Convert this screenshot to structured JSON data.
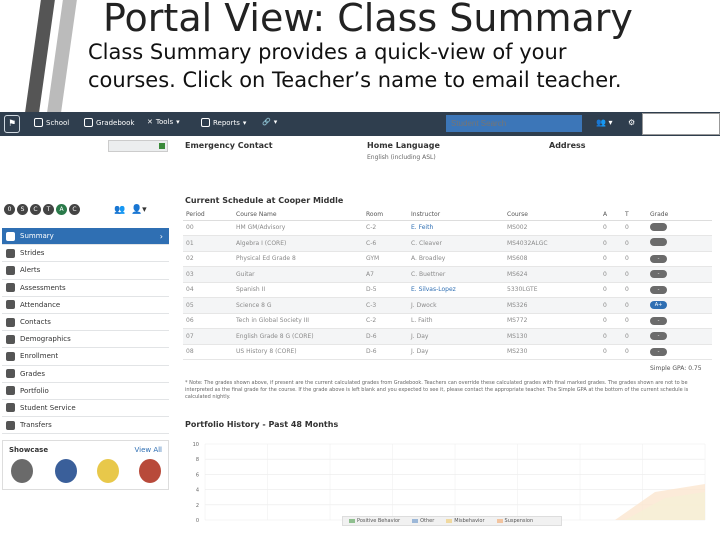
{
  "slide": {
    "title": "Portal View: Class Summary",
    "subtitle_line1": "Class Summary provides a quick-view of your",
    "subtitle_line2": "courses. Click on Teacher’s name to email teacher."
  },
  "navbar": {
    "school": "School",
    "gradebook": "Gradebook",
    "tools": "Tools",
    "reports": "Reports",
    "search_placeholder": "Student Search"
  },
  "left": {
    "circles": [
      "0",
      "S",
      "C",
      "T",
      "A",
      "C"
    ],
    "menu": [
      {
        "label": "Summary",
        "active": true
      },
      {
        "label": "Strides"
      },
      {
        "label": "Alerts"
      },
      {
        "label": "Assessments"
      },
      {
        "label": "Attendance"
      },
      {
        "label": "Contacts"
      },
      {
        "label": "Demographics"
      },
      {
        "label": "Enrollment"
      },
      {
        "label": "Grades"
      },
      {
        "label": "Portfolio"
      },
      {
        "label": "Student Service"
      },
      {
        "label": "Transfers"
      }
    ],
    "showcase_title": "Showcase",
    "view_all": "View All"
  },
  "main": {
    "emergency_contact": "Emergency Contact",
    "home_language": "Home Language",
    "home_language_value": "English (including ASL)",
    "address": "Address",
    "schedule_title": "Current Schedule at Cooper Middle",
    "columns": [
      "Period",
      "Course Name",
      "Room",
      "Instructor",
      "Course",
      "A",
      "T",
      "Grade"
    ],
    "rows": [
      [
        "00",
        "HM GM/Advisory",
        "C-2",
        "E. Feith",
        "MS002",
        "0",
        "0",
        ""
      ],
      [
        "01",
        "Algebra I (CORE)",
        "C-6",
        "C. Cleaver",
        "MS4032ALGC",
        "0",
        "0",
        ""
      ],
      [
        "02",
        "Physical Ed Grade 8",
        "GYM",
        "A. Broadley",
        "MS608",
        "0",
        "0",
        "-"
      ],
      [
        "03",
        "Guitar",
        "A7",
        "C. Buettner",
        "MS624",
        "0",
        "0",
        "-"
      ],
      [
        "04",
        "Spanish II",
        "D-5",
        "E. Silvas-Lopez",
        "5330LGTE",
        "0",
        "0",
        "-"
      ],
      [
        "05",
        "Science 8 G",
        "C-3",
        "J. Dwock",
        "MS326",
        "0",
        "0",
        "A+"
      ],
      [
        "06",
        "Tech in Global Society III",
        "C-2",
        "L. Faith",
        "MS772",
        "0",
        "0",
        "-"
      ],
      [
        "07",
        "English Grade 8 G (CORE)",
        "D-6",
        "J. Day",
        "MS130",
        "0",
        "0",
        "-"
      ],
      [
        "08",
        "US History 8 (CORE)",
        "D-6",
        "J. Day",
        "MS230",
        "0",
        "0",
        "-"
      ]
    ],
    "gpa": "Simple GPA: 0.75",
    "note": "* Note: The grades shown above, if present are the current calculated grades from Gradebook. Teachers can override these calculated grades with final marked grades. The grades shown are not to be interpreted as the final grade for the course. If the grade above is left blank and you expected to see it, please contact the appropriate teacher. The Simple GPA at the bottom of the current schedule is calculated nightly.",
    "portfolio_title": "Portfolio History - Past 48 Months"
  },
  "chart_data": {
    "type": "area",
    "title": "Portfolio History - Past 48 Months",
    "ylim": [
      0,
      10
    ],
    "y_ticks": [
      "10",
      "8",
      "6",
      "4",
      "2",
      "0"
    ],
    "series": [
      {
        "name": "Positive Behavior",
        "color": "#8fbf8f"
      },
      {
        "name": "Other",
        "color": "#9db8d8"
      },
      {
        "name": "Misbehavior",
        "color": "#f0d9a0"
      },
      {
        "name": "Suspension",
        "color": "#f2c4a0"
      }
    ]
  }
}
